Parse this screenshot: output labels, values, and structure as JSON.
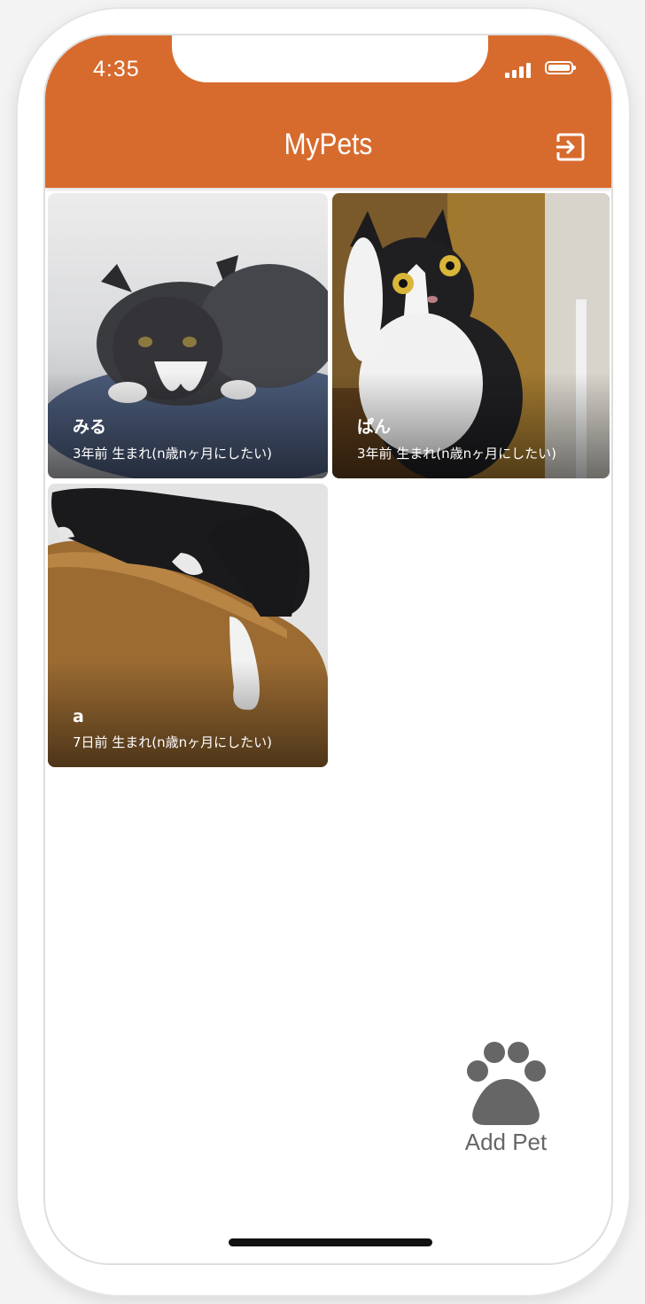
{
  "status_bar": {
    "time": "4:35"
  },
  "header": {
    "title": "MyPets",
    "background_color": "#d76b2e",
    "logout_icon": "logout-icon"
  },
  "pets": [
    {
      "name": "みる",
      "birth_info": "3年前 生まれ(n歳nヶ月にしたい)"
    },
    {
      "name": "ぱん",
      "birth_info": "3年前 生まれ(n歳nヶ月にしたい)"
    },
    {
      "name": "a",
      "birth_info": "7日前 生まれ(n歳nヶ月にしたい)"
    }
  ],
  "add_pet": {
    "label": "Add Pet",
    "icon": "paw-icon",
    "color": "#666666"
  }
}
